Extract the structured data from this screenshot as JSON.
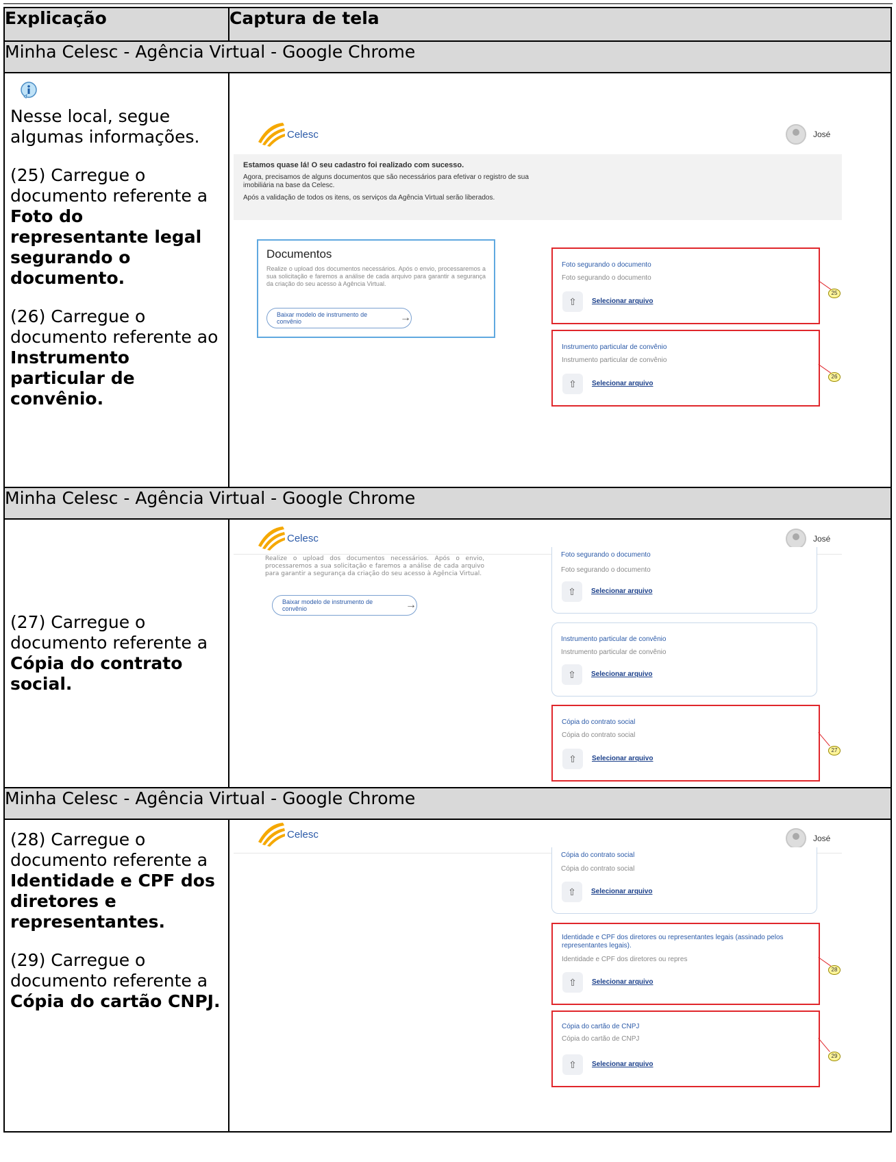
{
  "header": {
    "col1": "Explicação",
    "col2": "Captura de tela"
  },
  "window_title": "Minha Celesc - Agência Virtual - Google Chrome",
  "section1": {
    "intro": "Nesse local, segue algumas informações.",
    "step25_prefix": "(25) Carregue o documento referente a ",
    "step25_bold": "Foto do representante legal segurando o documento.",
    "step26_prefix": "(26) Carregue o documento referente ao ",
    "step26_bold": "Instrumento particular de convênio.",
    "shot": {
      "brand": "Celesc",
      "user": "José",
      "banner_title": "Estamos quase lá! O seu cadastro foi realizado com sucesso.",
      "banner_line1": "Agora, precisamos de alguns documentos que são necessários para efetivar o registro de sua imobiliária na base da Celesc.",
      "banner_line2": "Após a validação de todos os itens, os serviços da Agência Virtual serão liberados.",
      "docs_title": "Documentos",
      "docs_text": "Realize o upload dos documentos necessários. Após o envio, processaremos a sua solicitação e faremos a análise de cada arquivo para garantir a segurança da criação do seu acesso à Agência Virtual.",
      "docs_button": "Baixar modelo de instrumento de convênio",
      "card1_title": "Foto segurando o documento",
      "card1_sub": "Foto segurando o documento",
      "card2_title": "Instrumento particular de convênio",
      "card2_sub": "Instrumento particular de convênio",
      "select_label": "Selecionar arquivo",
      "callout_a": "25",
      "callout_b": "26"
    }
  },
  "section2": {
    "step27_prefix": "(27) Carregue o documento referente a ",
    "step27_bold": "Cópia do contrato social.",
    "shot": {
      "brand": "Celesc",
      "user": "José",
      "docs_text": "Realize o upload dos documentos necessários. Após o envio, processaremos a sua solicitação e faremos a análise de cada arquivo para garantir a segurança da criação do seu acesso à Agência Virtual.",
      "docs_button": "Baixar modelo de instrumento de convênio",
      "card1_title": "Foto segurando o documento",
      "card1_sub": "Foto segurando o documento",
      "card2_title": "Instrumento particular de convênio",
      "card2_sub": "Instrumento particular de convênio",
      "card3_title": "Cópia do contrato social",
      "card3_sub": "Cópia do contrato social",
      "select_label": "Selecionar arquivo",
      "callout_a": "27"
    }
  },
  "section3": {
    "step28_prefix": "(28) Carregue o documento referente a",
    "step28_bold": "Identidade e CPF dos diretores e representantes.",
    "step29_prefix": "(29) Carregue o documento referente a ",
    "step29_bold": "Cópia do cartão CNPJ.",
    "shot": {
      "brand": "Celesc",
      "user": "José",
      "card1_title": "Cópia do contrato social",
      "card1_sub": "Cópia do contrato social",
      "card2_title": "Identidade e CPF dos diretores ou representantes legais (assinado pelos representantes legais).",
      "card2_sub": "Identidade e CPF dos diretores ou repres",
      "card3_title": "Cópia do cartão de CNPJ",
      "card3_sub": "Cópia do cartão de CNPJ",
      "select_label": "Selecionar arquivo",
      "callout_a": "28",
      "callout_b": "29"
    }
  },
  "colors": {
    "header_bg": "#d9d9d9",
    "red_highlight": "#e0262b",
    "blue_highlight": "#5fa8e0",
    "link": "#2b5aa8"
  },
  "icons": {
    "info": "info-icon",
    "upload": "upload-icon",
    "logo": "celesc-logo"
  }
}
